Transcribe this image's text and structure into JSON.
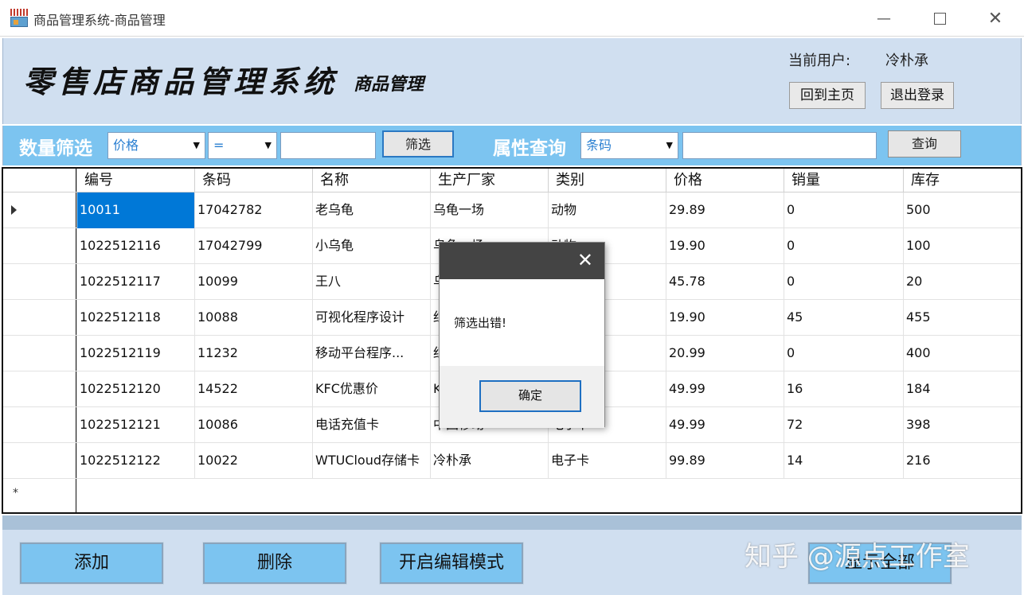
{
  "window": {
    "title": "商品管理系统-商品管理",
    "minimize": "—",
    "close": "✕"
  },
  "header": {
    "logo_title": "零售店商品管理系统",
    "logo_sub": "商品管理",
    "user_label": "当前用户:",
    "user_name": "冷朴承",
    "home_button": "回到主页",
    "logout_button": "退出登录"
  },
  "filter": {
    "quantity_label": "数量筛选",
    "field_select": "价格",
    "operator_select": "=",
    "value": "",
    "filter_button": "筛选",
    "attr_label": "属性查询",
    "attr_select": "条码",
    "attr_value": "",
    "query_button": "查询"
  },
  "table": {
    "columns": [
      "编号",
      "条码",
      "名称",
      "生产厂家",
      "类别",
      "价格",
      "销量",
      "库存"
    ],
    "rows": [
      [
        "10011",
        "17042782",
        "老乌龟",
        "乌龟一场",
        "动物",
        "29.89",
        "0",
        "500"
      ],
      [
        "1022512116",
        "17042799",
        "小乌龟",
        "乌龟一场",
        "动物",
        "19.90",
        "0",
        "100"
      ],
      [
        "1022512117",
        "10099",
        "王八",
        "乌",
        "",
        "45.78",
        "0",
        "20"
      ],
      [
        "1022512118",
        "10088",
        "可视化程序设计",
        "红",
        "",
        "19.90",
        "45",
        "455"
      ],
      [
        "1022512119",
        "11232",
        "移动平台程序...",
        "红",
        "",
        "20.99",
        "0",
        "400"
      ],
      [
        "1022512120",
        "14522",
        "KFC优惠价",
        "K",
        "",
        "49.99",
        "16",
        "184"
      ],
      [
        "1022512121",
        "10086",
        "电话充值卡",
        "中国移动",
        "电子卡",
        "49.99",
        "72",
        "398"
      ],
      [
        "1022512122",
        "10022",
        "WTUCloud存储卡",
        "冷朴承",
        "电子卡",
        "99.89",
        "14",
        "216"
      ]
    ],
    "new_row_marker": "*"
  },
  "footer": {
    "add_button": "添加",
    "delete_button": "删除",
    "edit_button": "开启编辑模式",
    "show_all_button": "显示全部"
  },
  "watermark": "知乎 @源点工作室",
  "dialog": {
    "message": "筛选出错!",
    "ok_button": "确定",
    "close": "✕"
  },
  "colors": {
    "header_bg": "#d0dff0",
    "filter_bg": "#7cc4f0",
    "selection": "#0078d7",
    "dialog_title_bg": "#444444"
  }
}
